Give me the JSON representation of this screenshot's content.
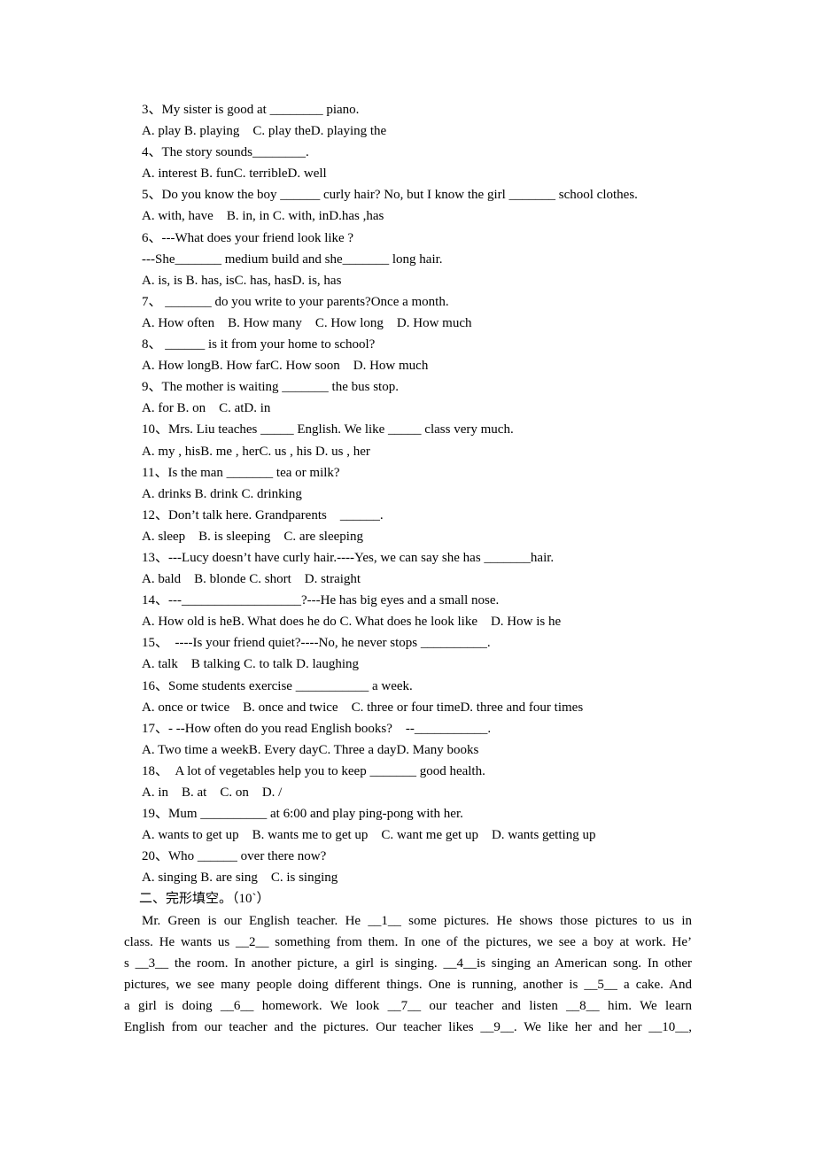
{
  "questions": [
    "3、My sister is good at ________ piano.",
    "A. play B. playing    C. play theD. playing the",
    "4、The story sounds________.",
    "A. interest B. funC. terribleD. well",
    "5、Do you know the boy ______ curly hair? No, but I know the girl _______ school clothes.",
    "A. with, have    B. in, in C. with, inD.has ,has",
    "6、---What does your friend look like ?",
    "---She_______ medium build and she_______ long hair.",
    "A. is, is B. has, isC. has, hasD. is, has",
    "7、 _______ do you write to your parents?Once a month.",
    "A. How often    B. How many    C. How long    D. How much",
    "8、 ______ is it from your home to school?",
    "A. How longB. How farC. How soon    D. How much",
    "9、The mother is waiting _______ the bus stop.",
    "A. for B. on    C. atD. in",
    "10、Mrs. Liu teaches _____ English. We like _____ class very much.",
    "A. my , hisB. me , herC. us , his D. us , her",
    "11、Is the man _______ tea or milk?",
    "A. drinks B. drink C. drinking",
    "12、Don’t talk here. Grandparents    ______.",
    "A. sleep    B. is sleeping    C. are sleeping",
    "13、---Lucy doesn’t have curly hair.----Yes, we can say she has _______hair.",
    "A. bald    B. blonde C. short    D. straight",
    "14、---__________________?---He has big eyes and a small nose.",
    "A. How old is heB. What does he do C. What does he look like    D. How is he",
    "15、  ----Is your friend quiet?----No, he never stops __________.",
    "A. talk    B talking C. to talk D. laughing",
    "16、Some students exercise ___________ a week.",
    "A. once or twice    B. once and twice    C. three or four timeD. three and four times",
    "17、- --How often do you read English books?    --___________.",
    "A. Two time a weekB. Every dayC. Three a dayD. Many books",
    "18、  A lot of vegetables help you to keep _______ good health.",
    "A. in    B. at    C. on    D. /",
    "19、Mum __________ at 6:00 and play ping-pong with her.",
    "A. wants to get up    B. wants me to get up    C. want me get up    D. wants getting up",
    "20、Who ______ over there now?",
    "A. singing B. are sing    C. is singing"
  ],
  "section_heading": "二、完形填空。（10`）",
  "passage_lines": [
    "Mr. Green is our English teacher. He __1__ some pictures. He shows those pictures to us in",
    "class. He wants us __2__ something from them. In one of the pictures, we see a boy at work. He’",
    "s __3__ the room. In another picture, a girl is singing. __4__is singing an American song. In other",
    "pictures, we see many people doing different things. One is running, another is __5__ a cake. And",
    "a girl is doing __6__ homework. We look __7__ our teacher and listen __8__ him. We learn",
    "English from our teacher and the pictures. Our teacher likes __9__. We like her and her __10__,"
  ]
}
